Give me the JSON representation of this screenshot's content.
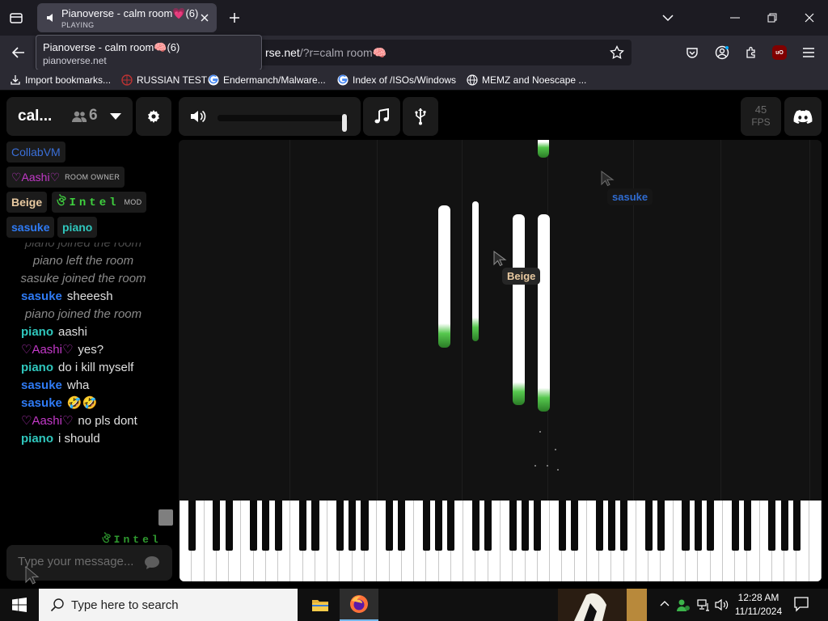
{
  "browser": {
    "tab": {
      "title": "Pianoverse - calm room💗(6)",
      "status": "PLAYING"
    },
    "tooltip": {
      "title": "Pianoverse - calm room🧠(6)",
      "url": "pianoverse.net"
    },
    "url": {
      "visible_host": "rse.net",
      "path": "/?r=calm room🧠"
    },
    "bookmarks": [
      {
        "label": "Import bookmarks...",
        "icon": "import-icon"
      },
      {
        "label": "RUSSIAN TEST",
        "icon": "globe-red-icon"
      },
      {
        "label": "Endermanch/Malware...",
        "icon": "google-icon"
      },
      {
        "label": "Index of /ISOs/Windows",
        "icon": "google-icon"
      },
      {
        "label": "MEMZ and Noescape ...",
        "icon": "globe-icon"
      }
    ]
  },
  "app": {
    "room": {
      "name": "cal...",
      "user_count": "6"
    },
    "fps": {
      "value": "45",
      "label": "FPS"
    },
    "volume_level": 0.97,
    "users": [
      {
        "name": "CollabVM",
        "color": "#3a6fd8",
        "role": ""
      },
      {
        "name": "♡Aashi♡",
        "color": "#c339c9",
        "role": "ROOM OWNER"
      },
      {
        "name": "Beige",
        "color": "#e8c9a0",
        "role": ""
      },
      {
        "name": "ঔIntel",
        "color": "#3fd13f",
        "role": "MOD"
      },
      {
        "name": "sasuke",
        "color": "#2f7bf5",
        "role": ""
      },
      {
        "name": "piano",
        "color": "#2fc7bd",
        "role": ""
      }
    ],
    "chat": [
      {
        "type": "sys",
        "text": "piano joined the room"
      },
      {
        "type": "sys",
        "text": "piano left the room"
      },
      {
        "type": "sys",
        "text": "sasuke joined the room"
      },
      {
        "type": "msg",
        "name": "sasuke",
        "color": "#2f7bf5",
        "text": "sheeesh"
      },
      {
        "type": "sys",
        "text": "piano joined the room"
      },
      {
        "type": "msg",
        "name": "piano",
        "color": "#2fc7bd",
        "text": "aashi"
      },
      {
        "type": "msg",
        "name": "♡Aashi♡",
        "color": "#c339c9",
        "text": "yes?"
      },
      {
        "type": "msg",
        "name": "piano",
        "color": "#2fc7bd",
        "text": "do i kill myself"
      },
      {
        "type": "msg",
        "name": "sasuke",
        "color": "#2f7bf5",
        "text": "wha"
      },
      {
        "type": "msg",
        "name": "sasuke",
        "color": "#2f7bf5",
        "text": "🤣🤣"
      },
      {
        "type": "msg",
        "name": "♡Aashi♡",
        "color": "#c339c9",
        "text": "no pls dont"
      },
      {
        "type": "msg",
        "name": "piano",
        "color": "#2fc7bd",
        "text": "i should"
      }
    ],
    "typing": "ঔIntel",
    "chat_placeholder": "Type your message...",
    "cursors": [
      {
        "name": "sasuke",
        "color": "#2f6bd0"
      },
      {
        "name": "Beige",
        "color": "#e8c9a0"
      }
    ]
  },
  "taskbar": {
    "search_placeholder": "Type here to search",
    "time": "12:28 AM",
    "date": "11/11/2024"
  }
}
